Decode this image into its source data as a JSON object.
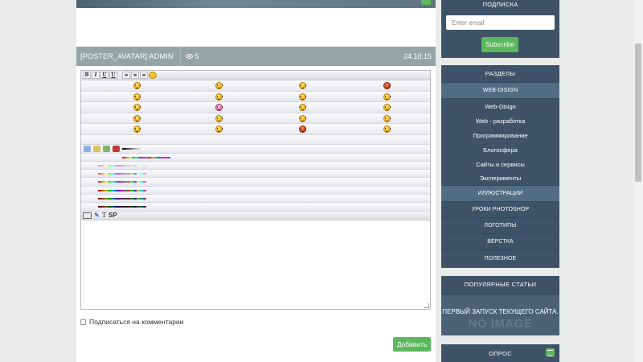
{
  "post": {
    "author": "[POSTER_AVATAR]  ADMIN",
    "views": "5",
    "date": "24.10.15"
  },
  "editor": {
    "toolbar": {
      "bold": "B",
      "italic": "I",
      "underline": "U",
      "strike": "U",
      "align_left": "≡",
      "align_center": "≡",
      "align_right": "≡"
    },
    "tools": {
      "text_tool": "T",
      "spoiler_tool": "SP"
    },
    "subscribe_label": "Подписаться на комментарии",
    "add_button": "Добавить"
  },
  "subscription": {
    "title": "ПОДПИСКА",
    "email_placeholder": "Enter email",
    "button": "Subscribe"
  },
  "categories": {
    "title": "РАЗДЕЛЫ",
    "active": "WEB-DISIGN",
    "subitems": [
      "Web-Disign",
      "Web - разработка",
      "Программирование",
      "Блогосфера",
      "Сайты и сервисы",
      "Эксперименты"
    ],
    "items": [
      "ИЛЛЮСТРАЦИИ",
      "УРОКИ PHOTOSHOP",
      "ЛОГОТИПЫ",
      "ВЁРСТКА",
      "ПОЛЕЗНОЕ"
    ]
  },
  "popular": {
    "title": "ПОПУЛЯРНЫЕ СТАТЬИ",
    "article": "ПЕРВЫЙ ЗАПУСК ТЕКУЩЕГО САЙТА.",
    "no_image": "NO IMAGE"
  },
  "poll": {
    "title": "ОПРОС"
  },
  "colors": {
    "sidebar": "#3e5367",
    "sidebar_active": "#526d83",
    "post_bar": "#95a4a4",
    "accent_green": "#5cb85c",
    "background": "#e9ebeb"
  }
}
